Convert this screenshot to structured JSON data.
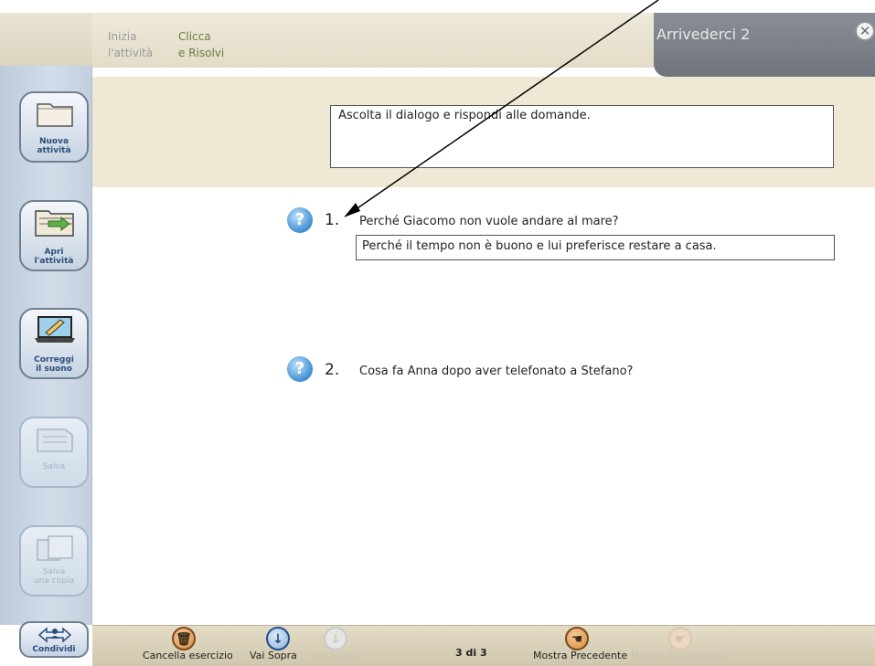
{
  "header": {
    "crumb_step1": "Inizia\nl'attività",
    "crumb_step2": "Clicca\ne Risolvi",
    "title": "Arrivederci 2",
    "close_glyph": "✕"
  },
  "sidebar": {
    "items": [
      {
        "label": "Nuova\nattività"
      },
      {
        "label": "Apri\nl'attività"
      },
      {
        "label": "Correggi\nil suono"
      },
      {
        "label": "Salva"
      },
      {
        "label": "Salva\nuna copia"
      },
      {
        "label": "Condividi"
      }
    ]
  },
  "instructions": "Ascolta il dialogo e rispondi alle domande.",
  "questions": [
    {
      "number": "1.",
      "text": "Perché Giacomo non vuole andare al mare?",
      "answer": "Perché il tempo non è buono e lui preferisce restare a casa."
    },
    {
      "number": "2.",
      "text": "Cosa fa Anna dopo aver telefonato a Stefano?",
      "answer": ""
    }
  ],
  "bottom": {
    "clear_label": "Cancella esercizio",
    "up_label": "Vai Sopra",
    "down_label": "Vai Sotto",
    "page_indicator": "3 di 3",
    "prev_label": "Mostra Precedente",
    "next_label": "Mostra Successivo"
  },
  "colors": {
    "accent_blue": "#2a4d7c",
    "header_tab": "#7d828a",
    "beige": "#efe8d4"
  },
  "icons": [
    "folder-icon",
    "open-folder-icon",
    "laptop-pencil-icon",
    "save-icon",
    "save-copy-icon",
    "share-icon",
    "question-icon",
    "trash-icon",
    "arrow-up-icon",
    "arrow-down-icon",
    "hand-left-icon",
    "hand-right-icon",
    "close-icon"
  ]
}
